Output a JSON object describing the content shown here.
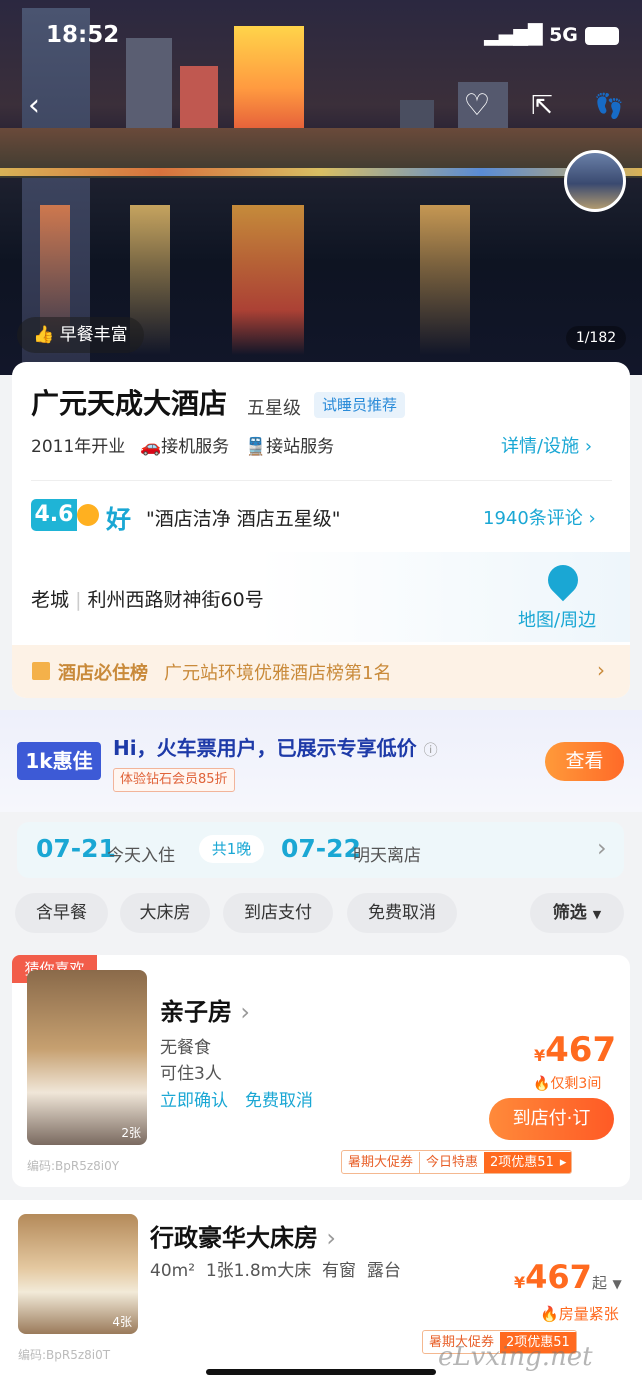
{
  "status": {
    "time": "18:52",
    "carrier": "5G"
  },
  "hero": {
    "tag": "早餐丰富",
    "counter": "1/182"
  },
  "hotel": {
    "name": "广元天成大酒店",
    "star": "五星级",
    "recommend": "试睡员推荐",
    "opened": "2011年开业",
    "airport": "接机服务",
    "station": "接站服务",
    "details_link": "详情/设施",
    "score": "4.6",
    "rating_word": "好",
    "quote": "\"酒店洁净  酒店五星级\"",
    "reviews": "1940条评论",
    "area": "老城",
    "address": "利州西路财神街60号",
    "map_link": "地图/周边",
    "rank_title": "酒店必住榜",
    "rank_text": "广元站环境优雅酒店榜第1名"
  },
  "promo": {
    "logo": "1k惠佳",
    "title": "Hi，火车票用户，已展示专享低价",
    "sub": "体验钻石会员85折",
    "button": "查看"
  },
  "dates": {
    "checkin": "07-21",
    "checkin_label": "今天入住",
    "nights": "共1晚",
    "checkout": "07-22",
    "checkout_label": "明天离店"
  },
  "filters": [
    "含早餐",
    "大床房",
    "到店支付",
    "免费取消",
    "筛选"
  ],
  "rooms": [
    {
      "badge": "猜你喜欢",
      "name": "亲子房",
      "line1": "无餐食",
      "line2": "可住3人",
      "perk1": "立即确认",
      "perk2": "免费取消",
      "price_symbol": "¥",
      "price": "467",
      "stock": "仅剩3间",
      "button": "到店付·订",
      "photos": "2张",
      "code": "编码:BpR5z8i0Y",
      "promo1": "暑期大促券",
      "promo2": "今日特惠",
      "promo3": "2项优惠51"
    },
    {
      "name": "行政豪华大床房",
      "line1": "40m²  1张1.8m大床  有窗  露台",
      "price_symbol": "¥",
      "price": "467",
      "price_suffix": "起",
      "stock": "房量紧张",
      "photos": "4张",
      "code": "编码:BpR5z8i0T",
      "promo1": "暑期大促券",
      "promo2": "2项优惠51"
    }
  ],
  "watermark": "eLvxing.net",
  "colors": {
    "accent": "#1aa7d4",
    "orange": "#ff6a1f",
    "gold": "#c98a3a"
  }
}
